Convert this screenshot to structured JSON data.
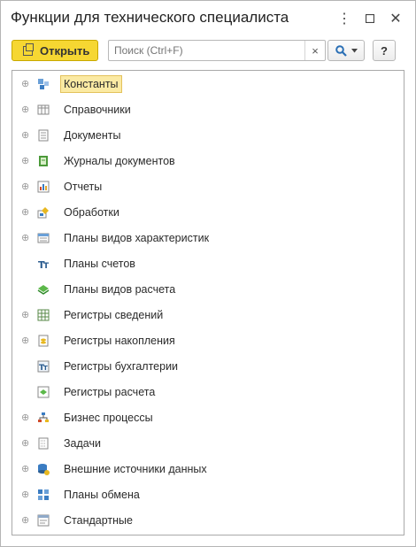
{
  "window": {
    "title": "Функции для технического специалиста"
  },
  "toolbar": {
    "open_label": "Открыть",
    "search_placeholder": "Поиск (Ctrl+F)",
    "clear_label": "×",
    "help_label": "?"
  },
  "tree": {
    "items": [
      {
        "label": "Константы",
        "expandable": true,
        "selected": true,
        "icon": "constants-icon"
      },
      {
        "label": "Справочники",
        "expandable": true,
        "icon": "catalogs-icon"
      },
      {
        "label": "Документы",
        "expandable": true,
        "icon": "documents-icon"
      },
      {
        "label": "Журналы документов",
        "expandable": true,
        "icon": "document-journals-icon"
      },
      {
        "label": "Отчеты",
        "expandable": true,
        "icon": "reports-icon"
      },
      {
        "label": "Обработки",
        "expandable": true,
        "icon": "data-processors-icon"
      },
      {
        "label": "Планы видов характеристик",
        "expandable": true,
        "icon": "characteristic-types-icon"
      },
      {
        "label": "Планы счетов",
        "expandable": false,
        "icon": "chart-of-accounts-icon"
      },
      {
        "label": "Планы видов расчета",
        "expandable": false,
        "icon": "calculation-types-icon"
      },
      {
        "label": "Регистры сведений",
        "expandable": true,
        "icon": "information-registers-icon"
      },
      {
        "label": "Регистры накопления",
        "expandable": true,
        "icon": "accumulation-registers-icon"
      },
      {
        "label": "Регистры бухгалтерии",
        "expandable": false,
        "icon": "accounting-registers-icon"
      },
      {
        "label": "Регистры расчета",
        "expandable": false,
        "icon": "calculation-registers-icon"
      },
      {
        "label": "Бизнес процессы",
        "expandable": true,
        "icon": "business-processes-icon"
      },
      {
        "label": "Задачи",
        "expandable": true,
        "icon": "tasks-icon"
      },
      {
        "label": "Внешние источники данных",
        "expandable": true,
        "icon": "external-data-sources-icon"
      },
      {
        "label": "Планы обмена",
        "expandable": true,
        "icon": "exchange-plans-icon"
      },
      {
        "label": "Стандартные",
        "expandable": true,
        "icon": "standard-icon"
      }
    ]
  },
  "colors": {
    "accent": "#f6d732",
    "selection": "#fbeaa3"
  }
}
